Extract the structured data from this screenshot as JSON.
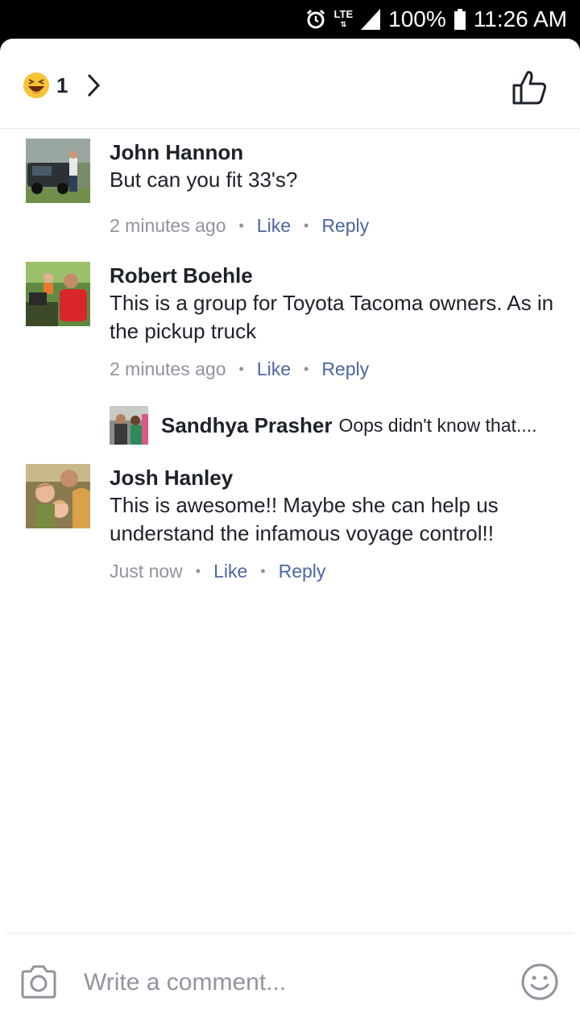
{
  "status_bar": {
    "network": "LTE",
    "battery": "100%",
    "time": "11:26 AM",
    "icons": [
      "alarm-icon",
      "lte-icon",
      "signal-icon",
      "battery-icon"
    ]
  },
  "reactions": {
    "icon": "haha-reaction-icon",
    "count": "1",
    "chevron_icon": "chevron-right-icon",
    "like_icon": "thumbs-up-icon"
  },
  "comments": [
    {
      "author": "John Hannon",
      "text": "But can you fit 33's?",
      "time": "2 minutes ago",
      "like": "Like",
      "reply": "Reply"
    },
    {
      "author": "Robert Boehle",
      "text": "This is a group for Toyota Tacoma owners. As in the pickup truck",
      "time": "2 minutes ago",
      "like": "Like",
      "reply": "Reply",
      "reply_preview": {
        "author": "Sandhya Prasher",
        "text": "Oops didn't know that...."
      }
    },
    {
      "author": "Josh Hanley",
      "text": "This is awesome!! Maybe she can help us understand  the infamous voyage control!!",
      "time": "Just now",
      "like": "Like",
      "reply": "Reply"
    }
  ],
  "composer": {
    "placeholder": "Write a comment...",
    "camera_icon": "camera-icon",
    "emoji_icon": "emoji-icon"
  },
  "colors": {
    "text": "#1d2129",
    "secondary": "#90949c",
    "link": "#4b67a1",
    "divider": "#e6e8eb"
  }
}
